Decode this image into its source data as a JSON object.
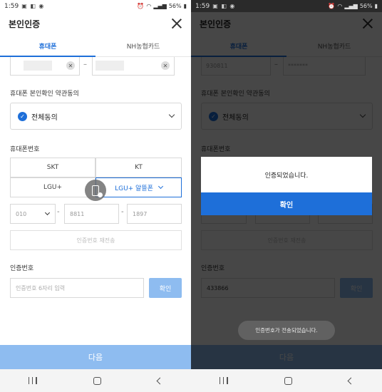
{
  "status_bar": {
    "time": "1:59",
    "battery": "56%"
  },
  "header": {
    "title": "본인인증"
  },
  "tabs": [
    {
      "label": "휴대폰",
      "active": true
    },
    {
      "label": "NH농협카드",
      "active": false
    }
  ],
  "masked_inputs": {
    "left_value_right": "930811",
    "right_value_right": "*******"
  },
  "agreement": {
    "label": "휴대폰 본인확인 약관동의",
    "value": "전체동의"
  },
  "phone": {
    "label": "휴대폰번호",
    "carriers": [
      "SKT",
      "KT",
      "LGU+",
      "LGU+ 알뜰폰"
    ],
    "selected_carrier": "LGU+ 알뜰폰",
    "prefix": "010",
    "middle": "8811",
    "last": "1897",
    "resend_label": "인증번호 재전송"
  },
  "code": {
    "label": "인증번호",
    "placeholder": "인증번호 6자리 입력",
    "confirm_label": "확인",
    "value_right": "433866"
  },
  "next_button": "다음",
  "dialog": {
    "message": "인증되었습니다.",
    "ok_label": "확인"
  },
  "toast": "인증번호가 전송되었습니다.",
  "colors": {
    "accent": "#1e6fd9",
    "disabled": "#8ebcf0"
  }
}
